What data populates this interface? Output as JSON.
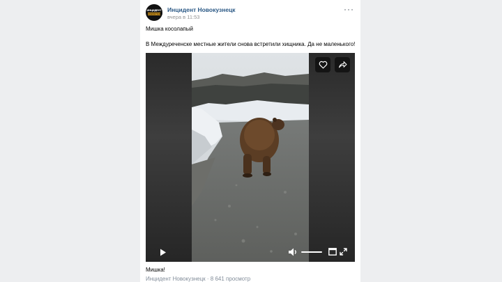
{
  "post": {
    "group_name": "Инцидент Новокузнецк",
    "avatar_text_line1": "ИНЦИДЕНТ",
    "avatar_text_line2": "НОВОКУЗНЕЦК",
    "time": "вчера в 11:53",
    "title": "Мишка косолапый",
    "text": "В Междуреченске местные жители снова встретили хищника. Да не маленького!"
  },
  "video": {
    "caption": "Мишка!",
    "meta": "Инцидент Новокузнецк · 8 641 просмотр",
    "icons": [
      "heart-icon",
      "share-icon",
      "play-icon",
      "volume-icon",
      "pip-icon",
      "fullscreen-icon"
    ],
    "volume_level": 1.0
  },
  "colors": {
    "background": "#edeef0",
    "link": "#2a5885",
    "muted": "#939393"
  }
}
